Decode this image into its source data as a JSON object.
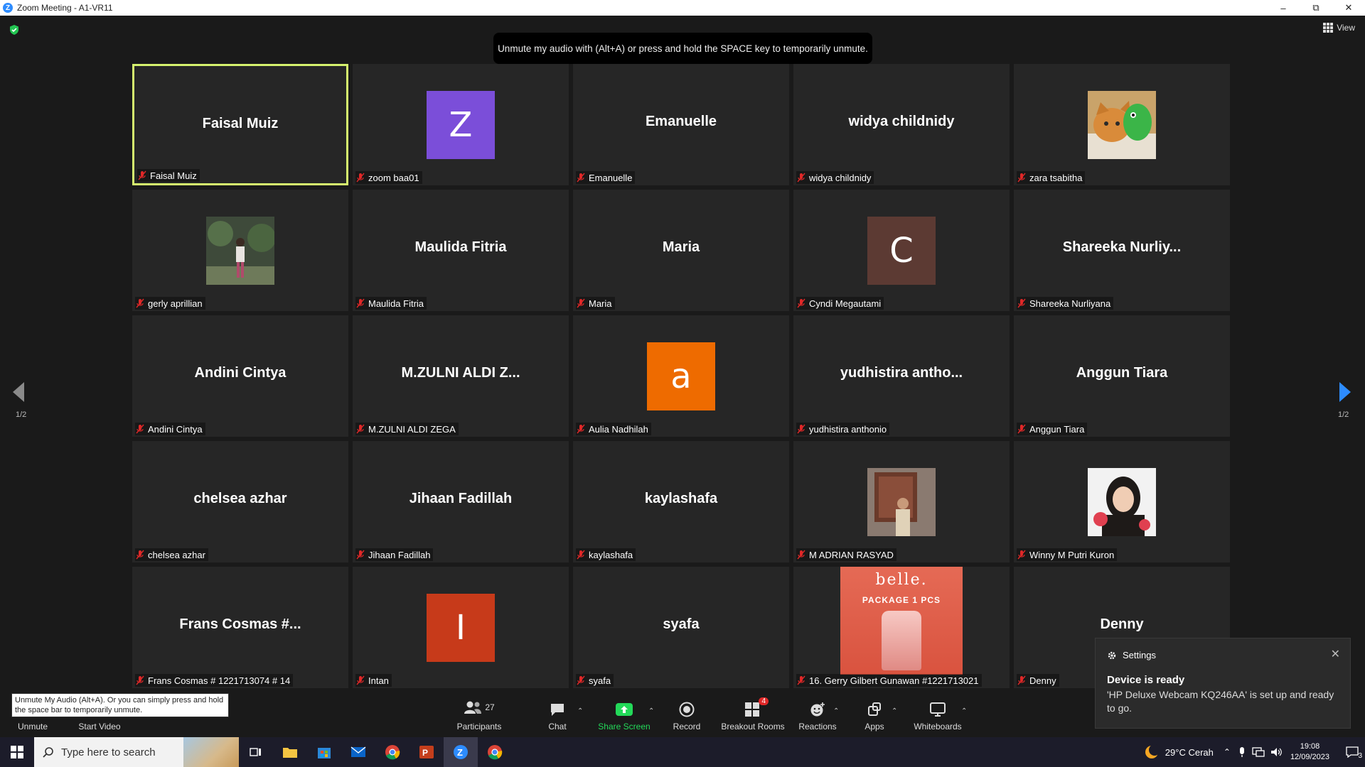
{
  "window": {
    "title": "Zoom Meeting - A1-VR11"
  },
  "top_tooltip": "Unmute my audio with (Alt+A) or press and hold the SPACE key to temporarily unmute.",
  "view_label": "View",
  "page_indicator": "1/2",
  "tiles": [
    {
      "big": "Faisal Muiz",
      "label": "Faisal Muiz",
      "active": true
    },
    {
      "avatar": "Z",
      "color": "#7b4ed9",
      "label": "zoom baa01"
    },
    {
      "big": "Emanuelle",
      "label": "Emanuelle"
    },
    {
      "big": "widya childnidy",
      "label": "widya childnidy"
    },
    {
      "photo": "cat-photo",
      "label": "zara tsabitha"
    },
    {
      "photo": "person-garden-photo",
      "label": "gerly aprillian"
    },
    {
      "big": "Maulida Fitria",
      "label": "Maulida Fitria"
    },
    {
      "big": "Maria",
      "label": "Maria"
    },
    {
      "avatar": "C",
      "color": "#5c3a33",
      "label": "Cyndi Megautami"
    },
    {
      "big": "Shareeka  Nurliy...",
      "label": "Shareeka Nurliyana"
    },
    {
      "big": "Andini Cintya",
      "label": "Andini Cintya"
    },
    {
      "big": "M.ZULNI  ALDI  Z...",
      "label": "M.ZULNI ALDI ZEGA"
    },
    {
      "avatar": "a",
      "color": "#ee6b00",
      "label": "Aulia Nadhilah"
    },
    {
      "big": "yudhistira  antho...",
      "label": "yudhistira anthonio"
    },
    {
      "big": "Anggun Tiara",
      "label": "Anggun Tiara"
    },
    {
      "big": "chelsea azhar",
      "label": "chelsea azhar"
    },
    {
      "big": "Jihaan Fadillah",
      "label": "Jihaan Fadillah"
    },
    {
      "big": "kaylashafa",
      "label": "kaylashafa"
    },
    {
      "photo": "man-photo",
      "label": "M ADRIAN RASYAD"
    },
    {
      "photo": "woman-photo",
      "label": "Winny M Putri Kuron"
    },
    {
      "big": "Frans Cosmas #...",
      "label": "Frans Cosmas # 1221713074 # 14"
    },
    {
      "avatar": "I",
      "color": "#c73a1a",
      "label": "Intan"
    },
    {
      "big": "syafa",
      "label": "syafa"
    },
    {
      "belle": true,
      "belle_title": "belle.",
      "belle_sub": "PACKAGE 1 PCS",
      "label": "16. Gerry Gilbert Gunawan #1221713021"
    },
    {
      "big": "Denny",
      "label": "Denny"
    }
  ],
  "toolbar": {
    "unmute": "Unmute",
    "start_video": "Start Video",
    "participants": "Participants",
    "participants_count": "27",
    "chat": "Chat",
    "share_screen": "Share Screen",
    "record": "Record",
    "breakout_rooms": "Breakout Rooms",
    "breakout_badge": "4",
    "reactions": "Reactions",
    "apps": "Apps",
    "whiteboards": "Whiteboards"
  },
  "unmute_tooltip": "Unmute My Audio (Alt+A). Or you can simply press and hold the space bar to temporarily unmute.",
  "toast": {
    "header": "Settings",
    "title": "Device is ready",
    "body": "'HP Deluxe Webcam KQ246AA' is set up and ready to go."
  },
  "taskbar": {
    "search_placeholder": "Type here to search",
    "weather": "29°C  Cerah",
    "time": "19:08",
    "date": "12/09/2023",
    "notif_count": "3"
  },
  "colors": {
    "active_border": "#d5f26e",
    "share_green": "#23d959",
    "accent_blue": "#2d8cff",
    "mic_red": "#e02828"
  }
}
